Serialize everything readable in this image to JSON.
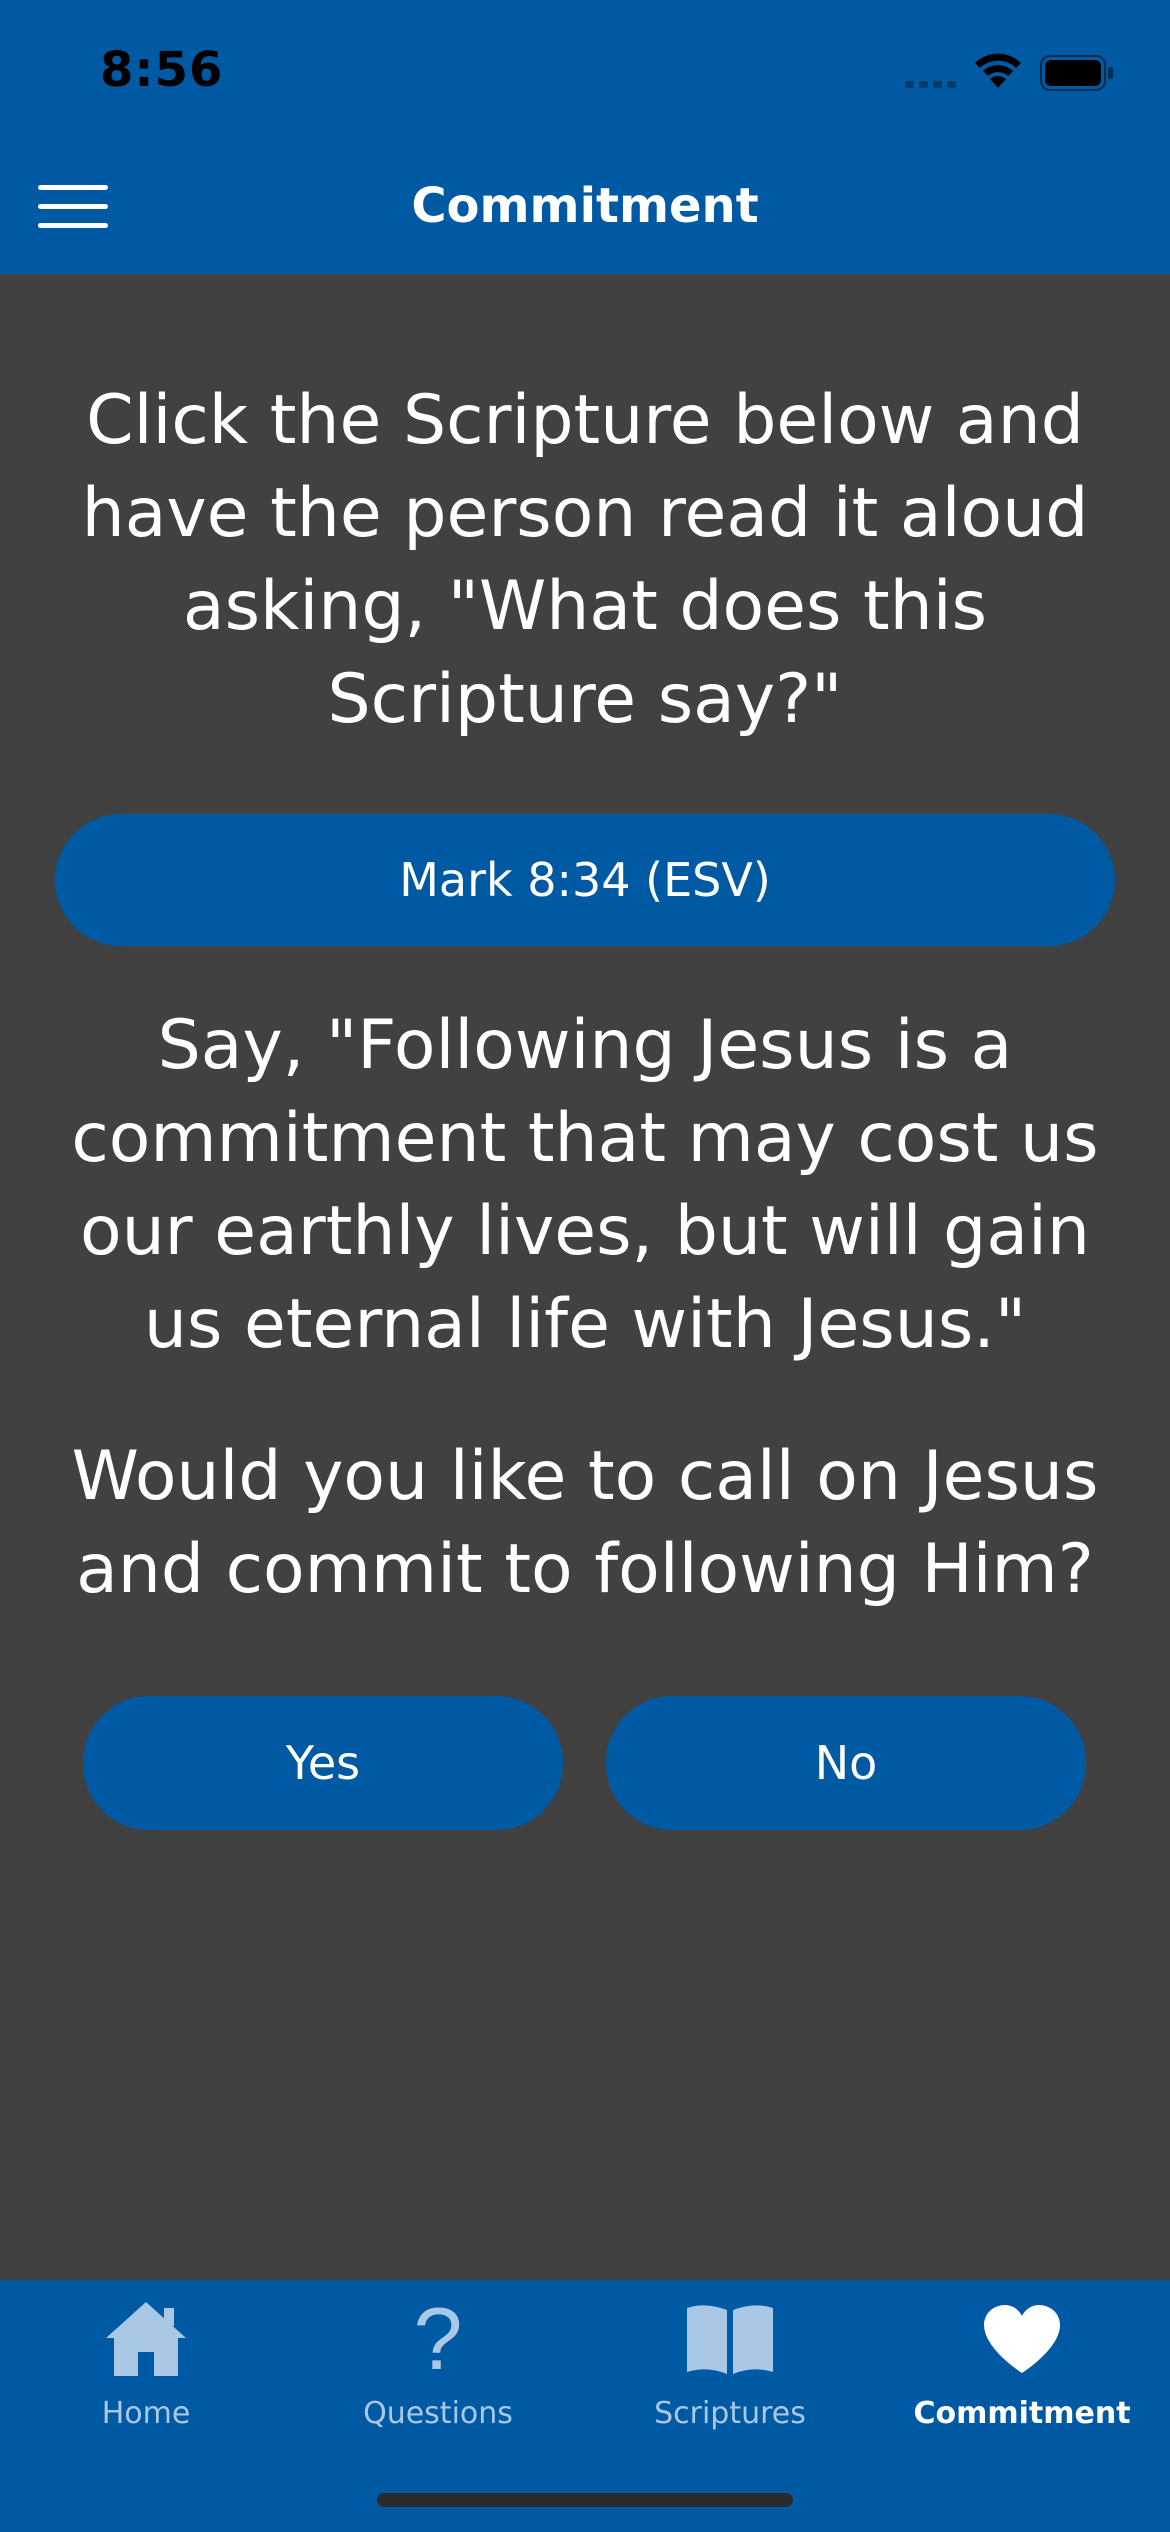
{
  "status_bar": {
    "time": "8:56"
  },
  "nav": {
    "title": "Commitment"
  },
  "content": {
    "instruction_lines": [
      "Click the Scripture below and",
      "have the person read it aloud",
      "asking, \"What does this",
      "Scripture say?\""
    ],
    "scripture_button_label": "Mark 8:34 (ESV)",
    "say_lines": [
      "Say, \"Following Jesus is a",
      "commitment that may cost us",
      "our earthly lives, but will gain",
      "us eternal life with Jesus.\""
    ],
    "question_lines": [
      "Would you like to call on Jesus",
      "and commit to following Him?"
    ],
    "yes_label": "Yes",
    "no_label": "No"
  },
  "tabs": [
    {
      "label": "Home",
      "icon": "house-icon"
    },
    {
      "label": "Questions",
      "icon": "question-mark-icon"
    },
    {
      "label": "Scriptures",
      "icon": "open-book-icon"
    },
    {
      "label": "Commitment",
      "icon": "heart-icon",
      "active": true
    }
  ],
  "colors": {
    "brand_blue": "#0059a3",
    "background": "#414141",
    "tab_inactive": "#a9c8e6",
    "tab_active": "#ffffff"
  }
}
